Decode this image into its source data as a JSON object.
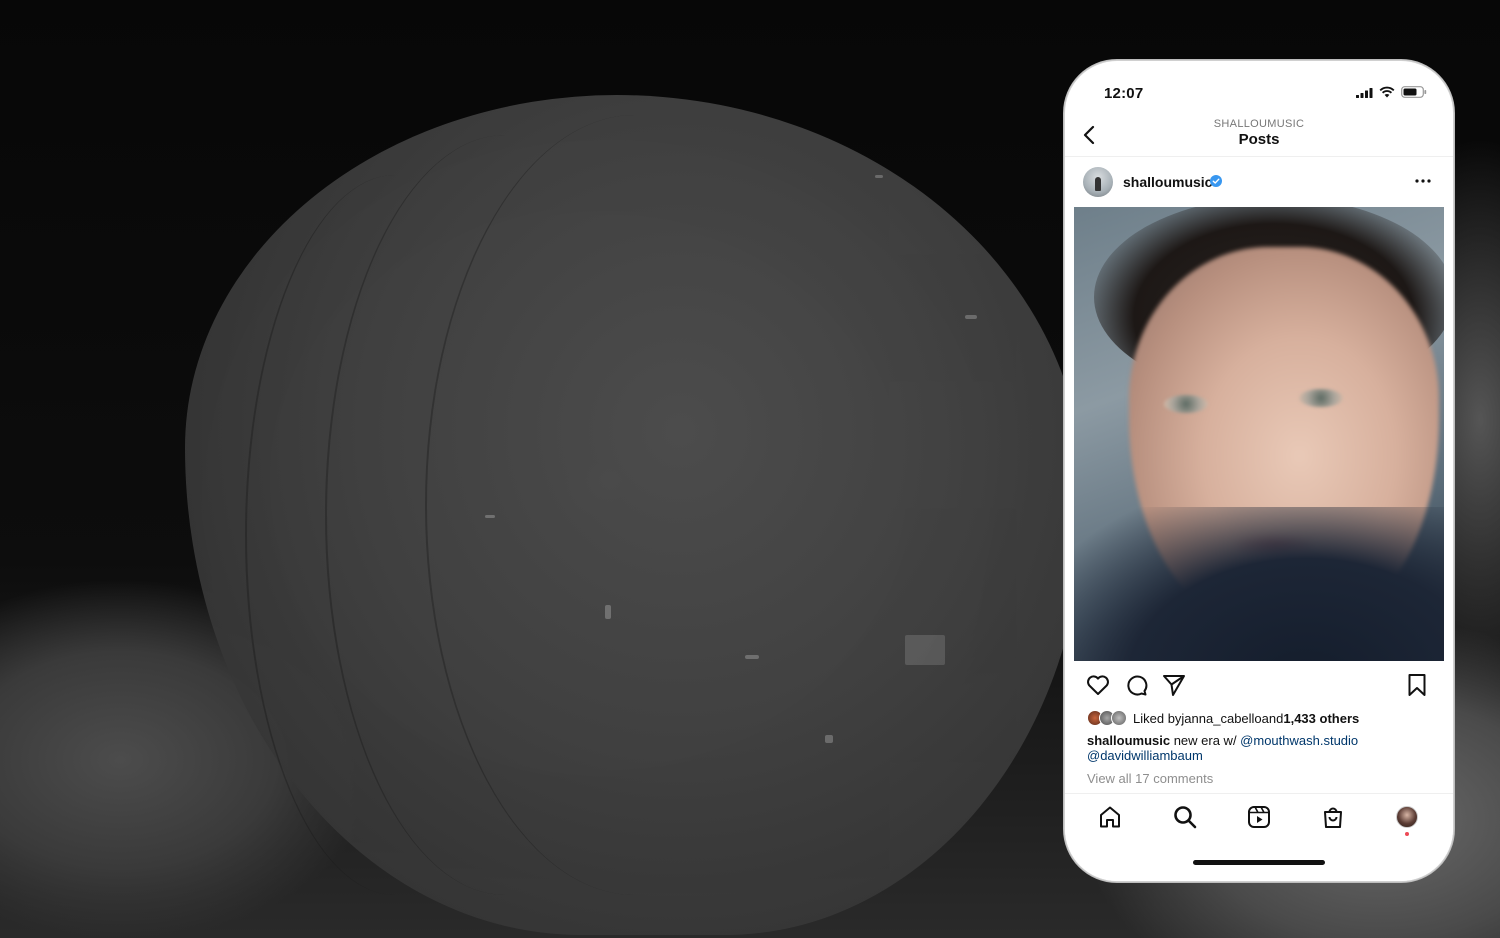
{
  "status_bar": {
    "time": "12:07"
  },
  "nav": {
    "account_label": "SHALLOUMUSIC",
    "title": "Posts"
  },
  "post": {
    "username": "shalloumusic",
    "likes": {
      "prefix": "Liked by ",
      "liker": "janna_cabello",
      "joiner": " and ",
      "others": "1,433 others"
    },
    "caption": {
      "username": "shalloumusic",
      "text": " new era w/ ",
      "mention_1": "@mouthwash.studio",
      "mention_2": "@davidwilliambaum"
    },
    "view_comments": "View all 17 comments"
  },
  "icons": {
    "back": "chevron-left-icon",
    "more": "more-horizontal-icon",
    "like": "heart-icon",
    "comment": "comment-icon",
    "share": "send-icon",
    "save": "bookmark-icon",
    "home": "home-icon",
    "search": "search-icon",
    "reels": "reels-icon",
    "shop": "shop-icon"
  },
  "colors": {
    "verified": "#3897f0",
    "mention": "#00376b",
    "muted": "#8e8e8e",
    "notification_dot": "#ed4956"
  }
}
